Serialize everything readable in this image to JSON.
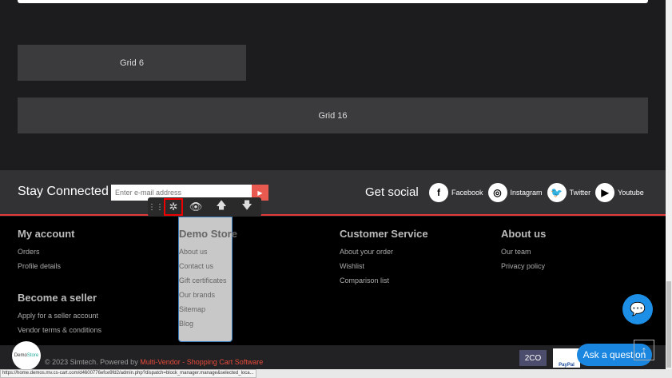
{
  "grids": {
    "grid6": "Grid 6",
    "grid16": "Grid 16"
  },
  "newsletter": {
    "title": "Stay Connected",
    "placeholder": "Enter e-mail address",
    "submit_icon": "play-icon"
  },
  "social": {
    "title": "Get social",
    "items": [
      {
        "label": "Facebook",
        "icon": "f"
      },
      {
        "label": "Instagram",
        "icon": "◎"
      },
      {
        "label": "Twitter",
        "icon": "🐦"
      },
      {
        "label": "Youtube",
        "icon": "▶"
      }
    ]
  },
  "toolbar": {
    "icons": [
      "drag-handle-icon",
      "gear-icon",
      "eye-icon",
      "arrow-up-icon",
      "arrow-down-icon"
    ]
  },
  "footer": {
    "my_account": {
      "title": "My account",
      "links": [
        "Orders",
        "Profile details"
      ]
    },
    "seller": {
      "title": "Become a seller",
      "links": [
        "Apply for a seller account",
        "Vendor terms & conditions"
      ]
    },
    "demo_store": {
      "title": "Demo Store",
      "links": [
        "About us",
        "Contact us",
        "Gift certificates",
        "Our brands",
        "Sitemap",
        "Blog"
      ]
    },
    "customer_service": {
      "title": "Customer Service",
      "links": [
        "About your order",
        "Wishlist",
        "Comparison list"
      ]
    },
    "about": {
      "title": "About us",
      "links": [
        "Our team",
        "Privacy policy"
      ]
    }
  },
  "bottom": {
    "logo_a": "Demo",
    "logo_b": "Store",
    "copyright": "© 2023 Simtech.  Powered by ",
    "powered_link": "Multi-Vendor - Shopping Cart Software",
    "pay1": "2CO",
    "pay2": "PayPal",
    "ask": "Ask a question"
  },
  "status_url": "https://home.demos.mv.cs-cart.com/d4600776efce9fd2/admin.php?dispatch=block_manager.manage&selected_loca..."
}
